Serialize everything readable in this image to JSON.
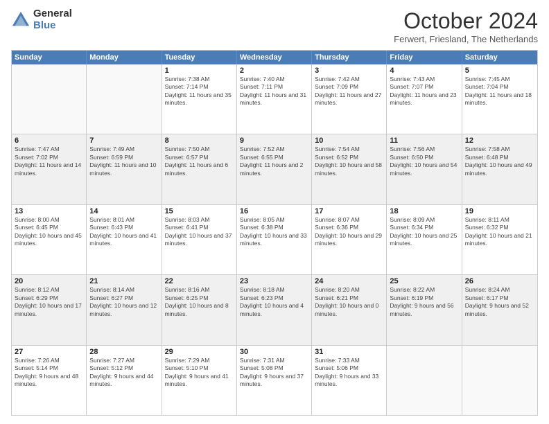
{
  "header": {
    "logo_general": "General",
    "logo_blue": "Blue",
    "title": "October 2024",
    "location": "Ferwert, Friesland, The Netherlands"
  },
  "weekdays": [
    "Sunday",
    "Monday",
    "Tuesday",
    "Wednesday",
    "Thursday",
    "Friday",
    "Saturday"
  ],
  "weeks": [
    [
      {
        "day": "",
        "info": "",
        "empty": true
      },
      {
        "day": "",
        "info": "",
        "empty": true
      },
      {
        "day": "1",
        "info": "Sunrise: 7:38 AM\nSunset: 7:14 PM\nDaylight: 11 hours and 35 minutes."
      },
      {
        "day": "2",
        "info": "Sunrise: 7:40 AM\nSunset: 7:11 PM\nDaylight: 11 hours and 31 minutes."
      },
      {
        "day": "3",
        "info": "Sunrise: 7:42 AM\nSunset: 7:09 PM\nDaylight: 11 hours and 27 minutes."
      },
      {
        "day": "4",
        "info": "Sunrise: 7:43 AM\nSunset: 7:07 PM\nDaylight: 11 hours and 23 minutes."
      },
      {
        "day": "5",
        "info": "Sunrise: 7:45 AM\nSunset: 7:04 PM\nDaylight: 11 hours and 18 minutes."
      }
    ],
    [
      {
        "day": "6",
        "info": "Sunrise: 7:47 AM\nSunset: 7:02 PM\nDaylight: 11 hours and 14 minutes."
      },
      {
        "day": "7",
        "info": "Sunrise: 7:49 AM\nSunset: 6:59 PM\nDaylight: 11 hours and 10 minutes."
      },
      {
        "day": "8",
        "info": "Sunrise: 7:50 AM\nSunset: 6:57 PM\nDaylight: 11 hours and 6 minutes."
      },
      {
        "day": "9",
        "info": "Sunrise: 7:52 AM\nSunset: 6:55 PM\nDaylight: 11 hours and 2 minutes."
      },
      {
        "day": "10",
        "info": "Sunrise: 7:54 AM\nSunset: 6:52 PM\nDaylight: 10 hours and 58 minutes."
      },
      {
        "day": "11",
        "info": "Sunrise: 7:56 AM\nSunset: 6:50 PM\nDaylight: 10 hours and 54 minutes."
      },
      {
        "day": "12",
        "info": "Sunrise: 7:58 AM\nSunset: 6:48 PM\nDaylight: 10 hours and 49 minutes."
      }
    ],
    [
      {
        "day": "13",
        "info": "Sunrise: 8:00 AM\nSunset: 6:45 PM\nDaylight: 10 hours and 45 minutes."
      },
      {
        "day": "14",
        "info": "Sunrise: 8:01 AM\nSunset: 6:43 PM\nDaylight: 10 hours and 41 minutes."
      },
      {
        "day": "15",
        "info": "Sunrise: 8:03 AM\nSunset: 6:41 PM\nDaylight: 10 hours and 37 minutes."
      },
      {
        "day": "16",
        "info": "Sunrise: 8:05 AM\nSunset: 6:38 PM\nDaylight: 10 hours and 33 minutes."
      },
      {
        "day": "17",
        "info": "Sunrise: 8:07 AM\nSunset: 6:36 PM\nDaylight: 10 hours and 29 minutes."
      },
      {
        "day": "18",
        "info": "Sunrise: 8:09 AM\nSunset: 6:34 PM\nDaylight: 10 hours and 25 minutes."
      },
      {
        "day": "19",
        "info": "Sunrise: 8:11 AM\nSunset: 6:32 PM\nDaylight: 10 hours and 21 minutes."
      }
    ],
    [
      {
        "day": "20",
        "info": "Sunrise: 8:12 AM\nSunset: 6:29 PM\nDaylight: 10 hours and 17 minutes."
      },
      {
        "day": "21",
        "info": "Sunrise: 8:14 AM\nSunset: 6:27 PM\nDaylight: 10 hours and 12 minutes."
      },
      {
        "day": "22",
        "info": "Sunrise: 8:16 AM\nSunset: 6:25 PM\nDaylight: 10 hours and 8 minutes."
      },
      {
        "day": "23",
        "info": "Sunrise: 8:18 AM\nSunset: 6:23 PM\nDaylight: 10 hours and 4 minutes."
      },
      {
        "day": "24",
        "info": "Sunrise: 8:20 AM\nSunset: 6:21 PM\nDaylight: 10 hours and 0 minutes."
      },
      {
        "day": "25",
        "info": "Sunrise: 8:22 AM\nSunset: 6:19 PM\nDaylight: 9 hours and 56 minutes."
      },
      {
        "day": "26",
        "info": "Sunrise: 8:24 AM\nSunset: 6:17 PM\nDaylight: 9 hours and 52 minutes."
      }
    ],
    [
      {
        "day": "27",
        "info": "Sunrise: 7:26 AM\nSunset: 5:14 PM\nDaylight: 9 hours and 48 minutes."
      },
      {
        "day": "28",
        "info": "Sunrise: 7:27 AM\nSunset: 5:12 PM\nDaylight: 9 hours and 44 minutes."
      },
      {
        "day": "29",
        "info": "Sunrise: 7:29 AM\nSunset: 5:10 PM\nDaylight: 9 hours and 41 minutes."
      },
      {
        "day": "30",
        "info": "Sunrise: 7:31 AM\nSunset: 5:08 PM\nDaylight: 9 hours and 37 minutes."
      },
      {
        "day": "31",
        "info": "Sunrise: 7:33 AM\nSunset: 5:06 PM\nDaylight: 9 hours and 33 minutes."
      },
      {
        "day": "",
        "info": "",
        "empty": true
      },
      {
        "day": "",
        "info": "",
        "empty": true
      }
    ]
  ]
}
